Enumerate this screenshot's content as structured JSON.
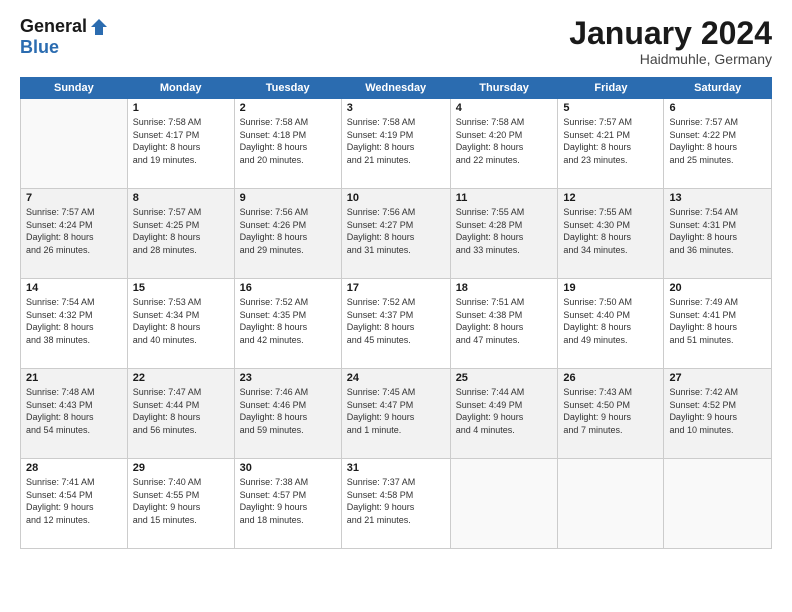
{
  "logo": {
    "general": "General",
    "blue": "Blue"
  },
  "header": {
    "title": "January 2024",
    "location": "Haidmuhle, Germany"
  },
  "weekdays": [
    "Sunday",
    "Monday",
    "Tuesday",
    "Wednesday",
    "Thursday",
    "Friday",
    "Saturday"
  ],
  "weeks": [
    [
      {
        "day": "",
        "info": ""
      },
      {
        "day": "1",
        "info": "Sunrise: 7:58 AM\nSunset: 4:17 PM\nDaylight: 8 hours\nand 19 minutes."
      },
      {
        "day": "2",
        "info": "Sunrise: 7:58 AM\nSunset: 4:18 PM\nDaylight: 8 hours\nand 20 minutes."
      },
      {
        "day": "3",
        "info": "Sunrise: 7:58 AM\nSunset: 4:19 PM\nDaylight: 8 hours\nand 21 minutes."
      },
      {
        "day": "4",
        "info": "Sunrise: 7:58 AM\nSunset: 4:20 PM\nDaylight: 8 hours\nand 22 minutes."
      },
      {
        "day": "5",
        "info": "Sunrise: 7:57 AM\nSunset: 4:21 PM\nDaylight: 8 hours\nand 23 minutes."
      },
      {
        "day": "6",
        "info": "Sunrise: 7:57 AM\nSunset: 4:22 PM\nDaylight: 8 hours\nand 25 minutes."
      }
    ],
    [
      {
        "day": "7",
        "info": "Sunrise: 7:57 AM\nSunset: 4:24 PM\nDaylight: 8 hours\nand 26 minutes."
      },
      {
        "day": "8",
        "info": "Sunrise: 7:57 AM\nSunset: 4:25 PM\nDaylight: 8 hours\nand 28 minutes."
      },
      {
        "day": "9",
        "info": "Sunrise: 7:56 AM\nSunset: 4:26 PM\nDaylight: 8 hours\nand 29 minutes."
      },
      {
        "day": "10",
        "info": "Sunrise: 7:56 AM\nSunset: 4:27 PM\nDaylight: 8 hours\nand 31 minutes."
      },
      {
        "day": "11",
        "info": "Sunrise: 7:55 AM\nSunset: 4:28 PM\nDaylight: 8 hours\nand 33 minutes."
      },
      {
        "day": "12",
        "info": "Sunrise: 7:55 AM\nSunset: 4:30 PM\nDaylight: 8 hours\nand 34 minutes."
      },
      {
        "day": "13",
        "info": "Sunrise: 7:54 AM\nSunset: 4:31 PM\nDaylight: 8 hours\nand 36 minutes."
      }
    ],
    [
      {
        "day": "14",
        "info": "Sunrise: 7:54 AM\nSunset: 4:32 PM\nDaylight: 8 hours\nand 38 minutes."
      },
      {
        "day": "15",
        "info": "Sunrise: 7:53 AM\nSunset: 4:34 PM\nDaylight: 8 hours\nand 40 minutes."
      },
      {
        "day": "16",
        "info": "Sunrise: 7:52 AM\nSunset: 4:35 PM\nDaylight: 8 hours\nand 42 minutes."
      },
      {
        "day": "17",
        "info": "Sunrise: 7:52 AM\nSunset: 4:37 PM\nDaylight: 8 hours\nand 45 minutes."
      },
      {
        "day": "18",
        "info": "Sunrise: 7:51 AM\nSunset: 4:38 PM\nDaylight: 8 hours\nand 47 minutes."
      },
      {
        "day": "19",
        "info": "Sunrise: 7:50 AM\nSunset: 4:40 PM\nDaylight: 8 hours\nand 49 minutes."
      },
      {
        "day": "20",
        "info": "Sunrise: 7:49 AM\nSunset: 4:41 PM\nDaylight: 8 hours\nand 51 minutes."
      }
    ],
    [
      {
        "day": "21",
        "info": "Sunrise: 7:48 AM\nSunset: 4:43 PM\nDaylight: 8 hours\nand 54 minutes."
      },
      {
        "day": "22",
        "info": "Sunrise: 7:47 AM\nSunset: 4:44 PM\nDaylight: 8 hours\nand 56 minutes."
      },
      {
        "day": "23",
        "info": "Sunrise: 7:46 AM\nSunset: 4:46 PM\nDaylight: 8 hours\nand 59 minutes."
      },
      {
        "day": "24",
        "info": "Sunrise: 7:45 AM\nSunset: 4:47 PM\nDaylight: 9 hours\nand 1 minute."
      },
      {
        "day": "25",
        "info": "Sunrise: 7:44 AM\nSunset: 4:49 PM\nDaylight: 9 hours\nand 4 minutes."
      },
      {
        "day": "26",
        "info": "Sunrise: 7:43 AM\nSunset: 4:50 PM\nDaylight: 9 hours\nand 7 minutes."
      },
      {
        "day": "27",
        "info": "Sunrise: 7:42 AM\nSunset: 4:52 PM\nDaylight: 9 hours\nand 10 minutes."
      }
    ],
    [
      {
        "day": "28",
        "info": "Sunrise: 7:41 AM\nSunset: 4:54 PM\nDaylight: 9 hours\nand 12 minutes."
      },
      {
        "day": "29",
        "info": "Sunrise: 7:40 AM\nSunset: 4:55 PM\nDaylight: 9 hours\nand 15 minutes."
      },
      {
        "day": "30",
        "info": "Sunrise: 7:38 AM\nSunset: 4:57 PM\nDaylight: 9 hours\nand 18 minutes."
      },
      {
        "day": "31",
        "info": "Sunrise: 7:37 AM\nSunset: 4:58 PM\nDaylight: 9 hours\nand 21 minutes."
      },
      {
        "day": "",
        "info": ""
      },
      {
        "day": "",
        "info": ""
      },
      {
        "day": "",
        "info": ""
      }
    ]
  ]
}
